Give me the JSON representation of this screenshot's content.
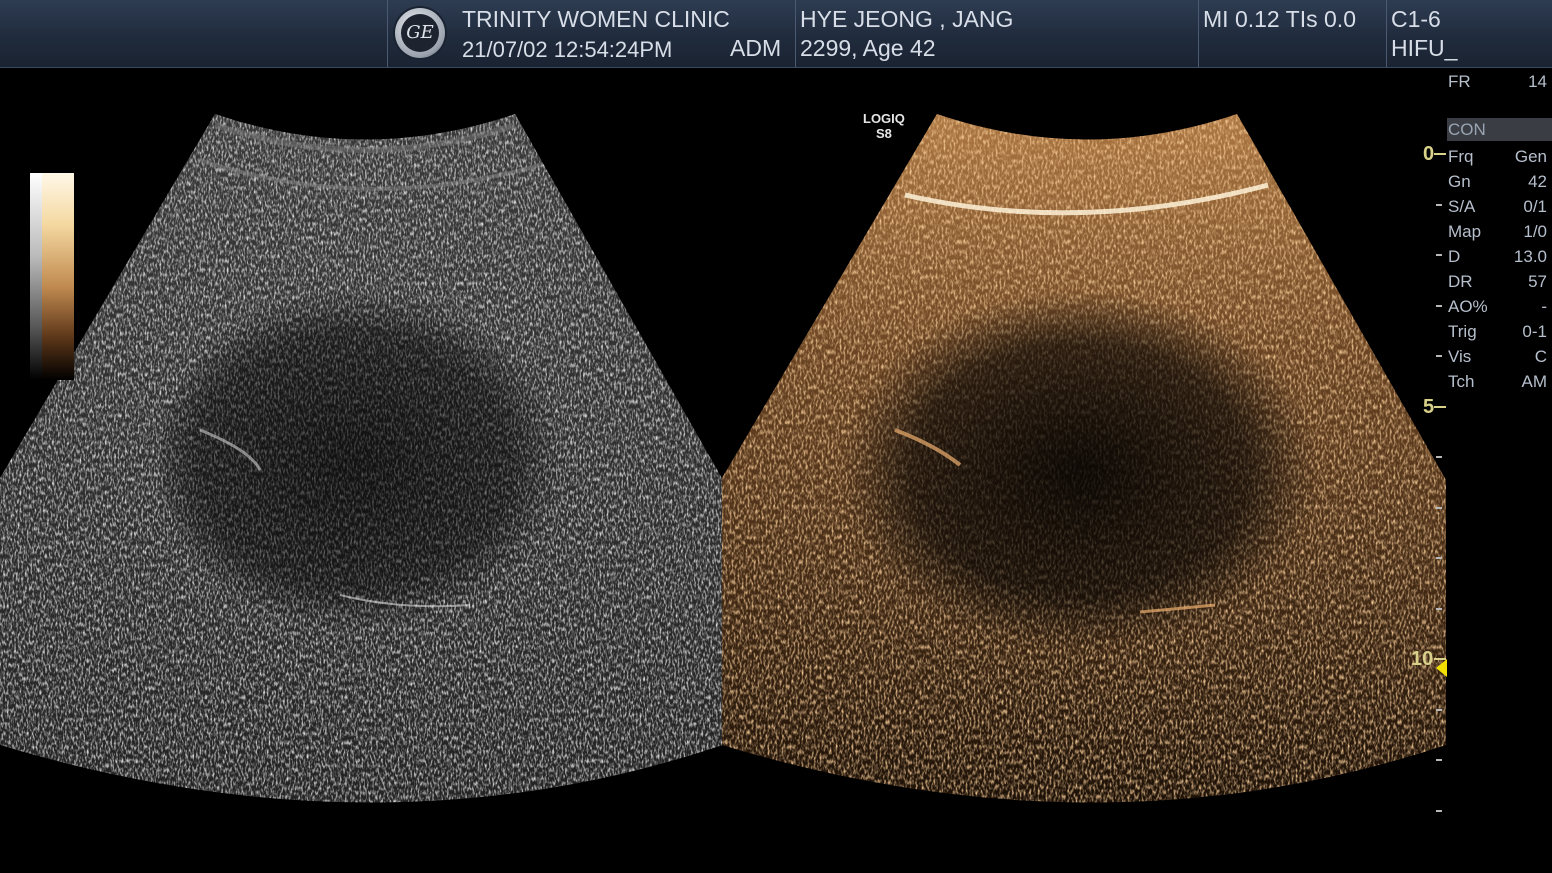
{
  "header": {
    "clinic": "TRINITY WOMEN CLINIC",
    "datetime": "21/07/02 12:54:24PM",
    "operator": "ADM",
    "patient_name": "HYE JEONG , JANG",
    "patient_info": "2299, Age 42",
    "mi_tis": "MI 0.12  TIs 0.0",
    "probe": "C1-6",
    "preset": "HIFU_"
  },
  "system_label": {
    "line1": "LOGIQ",
    "line2": "S8"
  },
  "params": {
    "fr": {
      "label": "FR",
      "value": "14"
    },
    "mode": "CON",
    "rows": [
      {
        "label": "Frq",
        "value": "Gen"
      },
      {
        "label": "Gn",
        "value": "42"
      },
      {
        "label": "S/A",
        "value": "0/1"
      },
      {
        "label": "Map",
        "value": "1/0"
      },
      {
        "label": "D",
        "value": "13.0"
      },
      {
        "label": "DR",
        "value": "57"
      },
      {
        "label": "AO%",
        "value": "-"
      },
      {
        "label": "Trig",
        "value": "0-1"
      },
      {
        "label": "Vis",
        "value": "C"
      },
      {
        "label": "Tch",
        "value": "AM"
      }
    ]
  },
  "depth_scale": {
    "labels": [
      "0",
      "5",
      "10"
    ],
    "max_depth_cm": 13.0,
    "focus_depth_cm": 10.2
  },
  "colors": {
    "header_bg": "#1f2a3b",
    "contrast_tint": "#c8864a",
    "depth_label": "#d9d18a",
    "focus_marker": "#f2e000"
  }
}
